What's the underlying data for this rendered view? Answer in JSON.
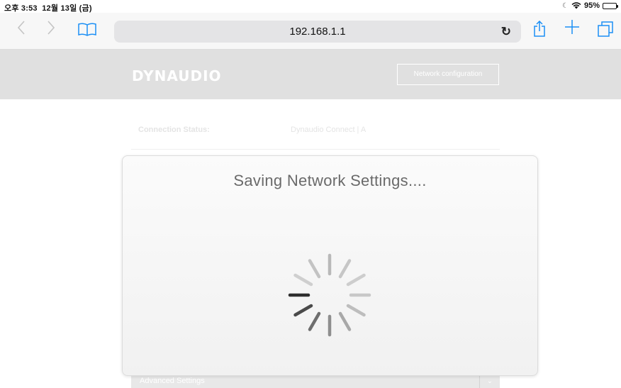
{
  "status_bar": {
    "time": "오후 3:53",
    "date": "12월 13일 (금)",
    "dnd_icon": "moon-icon",
    "wifi_icon": "wifi-icon",
    "battery_percent": "95%",
    "battery_level": 0.95
  },
  "browser": {
    "url": "192.168.1.1",
    "back_icon": "chevron-left-icon",
    "forward_icon": "chevron-right-icon",
    "bookmarks_icon": "book-icon",
    "reload_icon": "reload-icon",
    "share_icon": "share-icon",
    "new_tab_icon": "plus-icon",
    "tabs_icon": "tabs-icon",
    "accent_color": "#1b8ff5"
  },
  "site": {
    "logo_text": "DYNAUDIO",
    "network_config_label": "Network configuration",
    "header_color": "#e0e0e0",
    "connection_status_label": "Connection Status:",
    "connection_status_value": "Dynaudio Connect | A",
    "advanced_settings_label": "Advanced Settings"
  },
  "modal": {
    "title": "Saving Network Settings....",
    "spinner_icon": "loading-spinner-icon"
  }
}
